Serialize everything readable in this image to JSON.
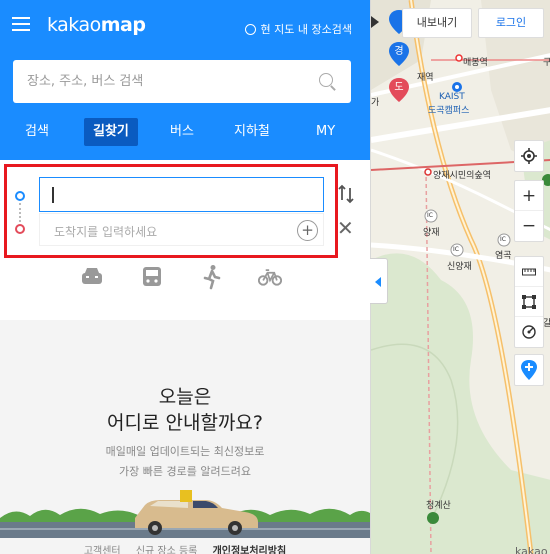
{
  "app": {
    "logo_regular": "kakao",
    "logo_bold": "map",
    "area_search_label": "현 지도 내 장소검색"
  },
  "search": {
    "placeholder": "장소, 주소, 버스 검색"
  },
  "tabs": [
    {
      "label": "검색"
    },
    {
      "label": "길찾기",
      "active": true
    },
    {
      "label": "버스"
    },
    {
      "label": "지하철"
    },
    {
      "label": "MY"
    }
  ],
  "route": {
    "start_value": "",
    "end_placeholder": "도착지를 입력하세요",
    "modes": [
      "car-icon",
      "bus-icon",
      "walk-icon",
      "bike-icon"
    ]
  },
  "hero": {
    "line1": "오늘은",
    "line2": "어디로 안내할까요?",
    "sub1": "매일매일 업데이트되는 최신정보로",
    "sub2": "가장 빠른 경로를 알려드려요"
  },
  "footer": {
    "links": [
      "고객센터",
      "신규 장소 등록",
      "개인정보처리방침"
    ]
  },
  "map": {
    "export_label": "내보내기",
    "login_label": "로그인",
    "markers": [
      {
        "label": "경",
        "color": "#1a73e8"
      },
      {
        "label": "도",
        "color": "#e34b5a"
      }
    ],
    "pois": [
      {
        "text": "재역"
      },
      {
        "text": "매봉역"
      },
      {
        "text": "KAIST"
      },
      {
        "text": "도곡캠퍼스"
      },
      {
        "text": "가"
      },
      {
        "text": "양재시민의숲역"
      },
      {
        "text": "IC"
      },
      {
        "text": "양재"
      },
      {
        "text": "IC"
      },
      {
        "text": "염곡"
      },
      {
        "text": "IC"
      },
      {
        "text": "신양재"
      },
      {
        "text": "청계산"
      },
      {
        "text": "구"
      },
      {
        "text": "갈"
      },
      {
        "text": "kakao"
      }
    ],
    "controls": [
      "locate-icon",
      "zoom-in-icon",
      "zoom-out-icon",
      "ruler-icon",
      "area-icon",
      "radius-icon",
      "roadview-icon"
    ]
  },
  "colors": {
    "brand": "#1a8cff",
    "highlight": "#e8181f",
    "active_tab": "#0a5bc0"
  }
}
